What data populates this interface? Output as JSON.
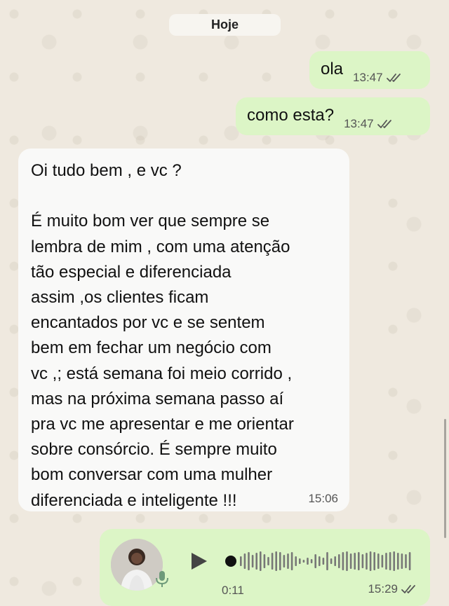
{
  "date_separator": "Hoje",
  "messages": [
    {
      "direction": "outgoing",
      "text": "ola",
      "time": "13:47",
      "status": "read"
    },
    {
      "direction": "outgoing",
      "text": "como esta?",
      "time": "13:47",
      "status": "read"
    },
    {
      "direction": "incoming",
      "text": "Oi tudo bem , e vc ?\n\nÉ muito bom ver que sempre se\nlembra de mim , com uma atenção\ntão especial e diferenciada\nassim ,os clientes ficam\nencantados por vc e se sentem\nbem em fechar um negócio com\nvc ,; está semana foi meio corrido ,\nmas na próxima semana passo aí\npra vc me apresentar e me orientar\nsobre consórcio. É sempre muito\nbom conversar com uma mulher\ndiferenciada e inteligente !!!",
      "time": "15:06"
    }
  ],
  "voice_message": {
    "duration": "0:11",
    "time": "15:29",
    "status": "read",
    "progress": 0
  },
  "colors": {
    "outgoing_bubble": "#dcf5c6",
    "incoming_bubble": "#f9f9f8",
    "read_ticks": "#555555",
    "background": "#efe9df"
  },
  "icons": [
    "double-check-icon",
    "play-icon",
    "microphone-icon",
    "waveform-icon",
    "avatar"
  ]
}
